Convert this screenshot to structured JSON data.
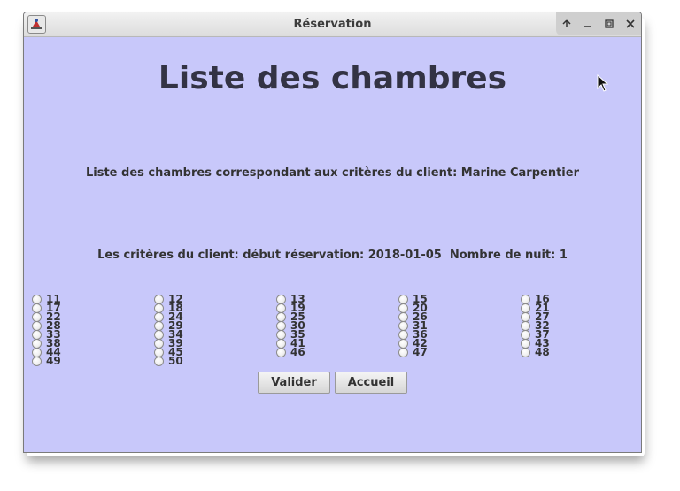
{
  "window": {
    "title": "Réservation",
    "controls": [
      "up-arrow-icon",
      "minimize-icon",
      "maximize-icon",
      "close-icon"
    ]
  },
  "main": {
    "title": "Liste des chambres",
    "subtitle": "Liste des chambres correspondant aux critères du client: Marine Carpentier",
    "criteria": "Les critères du client: début réservation: 2018-01-05  Nombre de nuit: 1"
  },
  "rooms": {
    "col1": [
      "11",
      "17",
      "22",
      "28",
      "33",
      "38",
      "44",
      "49"
    ],
    "col2": [
      "12",
      "18",
      "24",
      "29",
      "34",
      "39",
      "45",
      "50"
    ],
    "col3": [
      "13",
      "19",
      "25",
      "30",
      "35",
      "41",
      "46"
    ],
    "col4": [
      "15",
      "20",
      "26",
      "31",
      "36",
      "42",
      "47"
    ],
    "col5": [
      "16",
      "21",
      "27",
      "32",
      "37",
      "43",
      "48"
    ]
  },
  "buttons": {
    "validate": "Valider",
    "home": "Accueil"
  },
  "colors": {
    "background": "#c8c8fa",
    "title_text": "#333344"
  }
}
